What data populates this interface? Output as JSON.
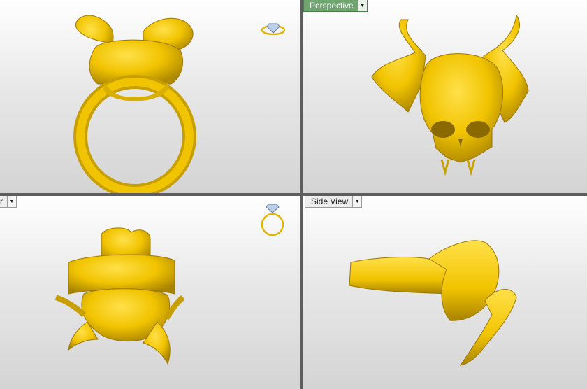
{
  "viewports": {
    "top_left": {
      "label": ""
    },
    "top_right": {
      "label": "Perspective",
      "active": true
    },
    "bottom_left": {
      "label": "r"
    },
    "bottom_right": {
      "label": "Side View"
    }
  },
  "icons": {
    "dropdown": "triangle-down",
    "orientation_ring_front": "ring-diamond-icon",
    "orientation_ring_top": "ring-diamond-top-icon"
  },
  "colors": {
    "model_gold": "#f1c400",
    "model_shadow": "#b08a00",
    "active_tab": "#6fa56f",
    "divider": "#5e5e5e"
  }
}
